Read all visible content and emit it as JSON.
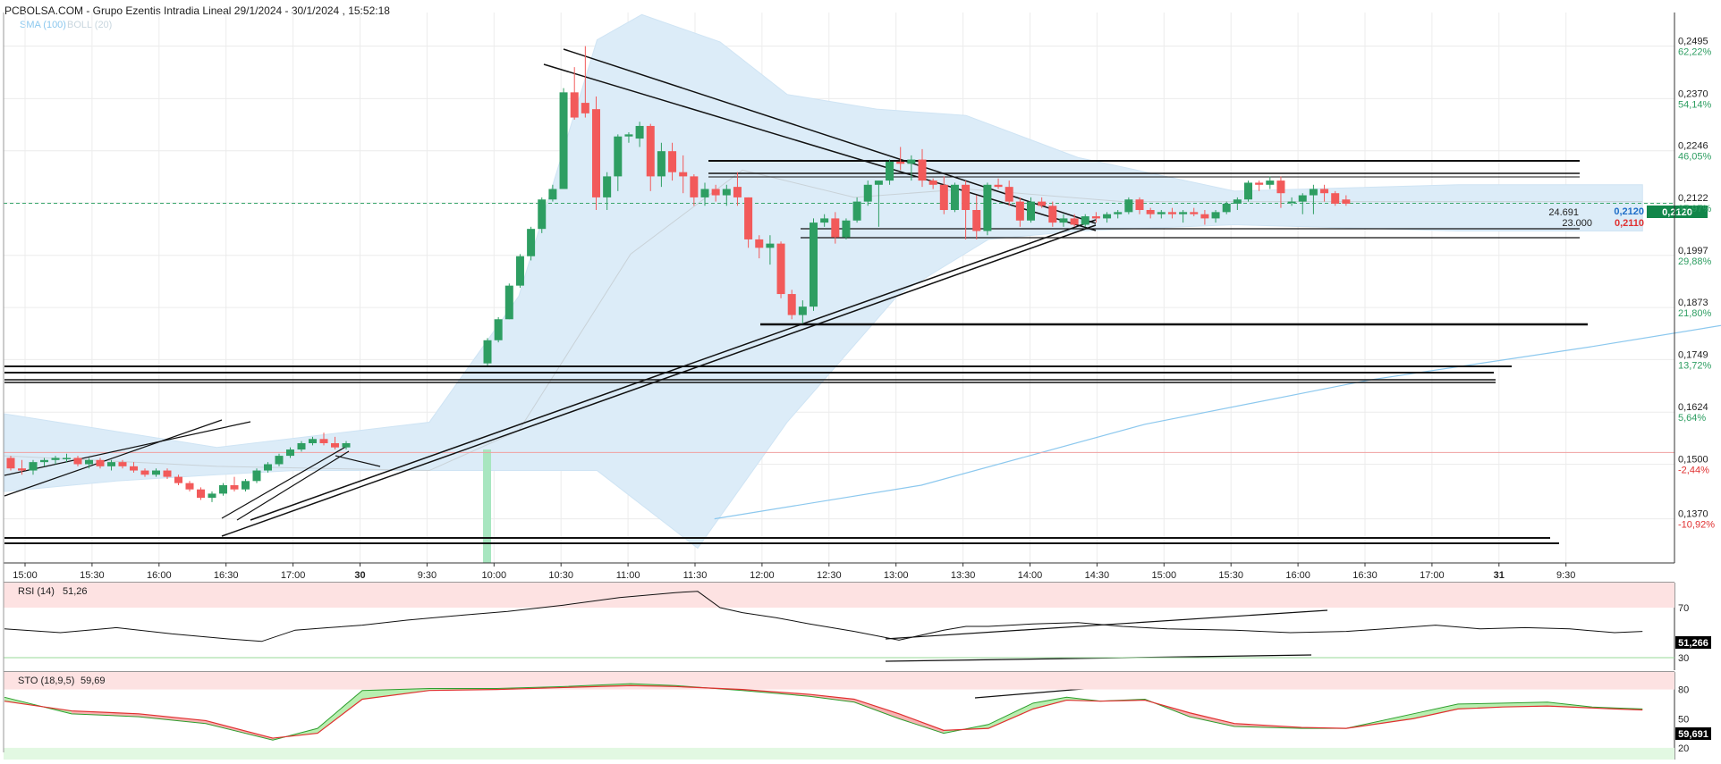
{
  "header": {
    "title": "PCBOLSA.COM - Grupo Ezentis Intradia Lineal 29/1/2024 - 30/1/2024 , 15:52:18",
    "legend": [
      {
        "label": "SMA (100)",
        "color": "#8cc8ee"
      },
      {
        "label": "BOLL (20)",
        "color": "#c8d6de"
      }
    ]
  },
  "colors": {
    "up": "#2e9e62",
    "down": "#f25a5a",
    "band": "#dcecf8",
    "sma": "#8cc8ee",
    "grid": "#ececec",
    "current_price_badge": "#12864a",
    "rsi_zone": "#fde2e2",
    "sto_low_zone": "#e2f8e2"
  },
  "chart_data": [
    {
      "type": "candlestick",
      "name": "price",
      "ylim": [
        0.1265,
        0.2575
      ],
      "y_ticks": [
        {
          "price": "0,2495",
          "pct": "62,22%"
        },
        {
          "price": "0,2370",
          "pct": "54,14%"
        },
        {
          "price": "0,2246",
          "pct": "46,05%"
        },
        {
          "price": "0,2122",
          "pct": "37,97%"
        },
        {
          "price": "0,1997",
          "pct": "29,88%"
        },
        {
          "price": "0,1873",
          "pct": "21,80%"
        },
        {
          "price": "0,1749",
          "pct": "13,72%"
        },
        {
          "price": "0,1624",
          "pct": "5,64%"
        },
        {
          "price": "0,1500",
          "pct": "-2,44%"
        },
        {
          "price": "0,1370",
          "pct": "-10,92%"
        }
      ],
      "x_ticks": [
        "15:00",
        "15:30",
        "16:00",
        "16:30",
        "17:00",
        "30",
        "9:30",
        "10:00",
        "10:30",
        "11:00",
        "11:30",
        "12:00",
        "12:30",
        "13:00",
        "13:30",
        "14:00",
        "14:30",
        "15:00",
        "15:30",
        "16:00",
        "16:30",
        "17:00",
        "31",
        "9:30"
      ],
      "price_tags": [
        {
          "text": "0,2120",
          "color": "#1e6ec8"
        },
        {
          "text": "0,2120",
          "color": "#12864a"
        },
        {
          "text": "0,2110",
          "color": "#e03030"
        }
      ],
      "volume_tags": [
        "24.691",
        "23.000"
      ],
      "candles": [
        [
          0.1515,
          0.152,
          0.1485,
          0.149
        ],
        [
          0.149,
          0.151,
          0.1475,
          0.1485
        ],
        [
          0.1485,
          0.151,
          0.1475,
          0.1505
        ],
        [
          0.1505,
          0.1515,
          0.1495,
          0.151
        ],
        [
          0.151,
          0.152,
          0.15,
          0.1515
        ],
        [
          0.1515,
          0.1525,
          0.1505,
          0.1515
        ],
        [
          0.1515,
          0.152,
          0.1495,
          0.15
        ],
        [
          0.15,
          0.1515,
          0.149,
          0.151
        ],
        [
          0.151,
          0.1515,
          0.149,
          0.1495
        ],
        [
          0.1495,
          0.151,
          0.1485,
          0.1505
        ],
        [
          0.1505,
          0.151,
          0.149,
          0.1495
        ],
        [
          0.1495,
          0.1505,
          0.148,
          0.1485
        ],
        [
          0.1485,
          0.149,
          0.147,
          0.1475
        ],
        [
          0.1475,
          0.149,
          0.147,
          0.1485
        ],
        [
          0.1485,
          0.149,
          0.1465,
          0.147
        ],
        [
          0.147,
          0.1475,
          0.145,
          0.1455
        ],
        [
          0.1455,
          0.146,
          0.1435,
          0.144
        ],
        [
          0.144,
          0.1445,
          0.1415,
          0.142
        ],
        [
          0.142,
          0.1435,
          0.141,
          0.143
        ],
        [
          0.143,
          0.1455,
          0.1425,
          0.145
        ],
        [
          0.145,
          0.147,
          0.1435,
          0.144
        ],
        [
          0.144,
          0.1465,
          0.1435,
          0.146
        ],
        [
          0.146,
          0.149,
          0.1455,
          0.1485
        ],
        [
          0.1485,
          0.1505,
          0.148,
          0.15
        ],
        [
          0.15,
          0.1525,
          0.1495,
          0.152
        ],
        [
          0.152,
          0.154,
          0.1515,
          0.1535
        ],
        [
          0.1535,
          0.1555,
          0.153,
          0.155
        ],
        [
          0.155,
          0.1565,
          0.1545,
          0.156
        ],
        [
          0.156,
          0.1575,
          0.1545,
          0.155
        ],
        [
          0.155,
          0.1565,
          0.1535,
          0.154
        ],
        [
          0.154,
          0.1555,
          0.1535,
          0.155
        ],
        [
          0.174,
          0.18,
          0.1735,
          0.1795
        ],
        [
          0.1795,
          0.185,
          0.179,
          0.1845
        ],
        [
          0.1845,
          0.193,
          0.1845,
          0.1925
        ],
        [
          0.1925,
          0.2,
          0.192,
          0.1995
        ],
        [
          0.1995,
          0.2065,
          0.1985,
          0.206
        ],
        [
          0.206,
          0.2135,
          0.205,
          0.213
        ],
        [
          0.213,
          0.2165,
          0.2125,
          0.2155
        ],
        [
          0.2155,
          0.2395,
          0.2155,
          0.2385
        ],
        [
          0.2385,
          0.2445,
          0.232,
          0.2325
        ],
        [
          0.236,
          0.2495,
          0.2325,
          0.2335
        ],
        [
          0.2345,
          0.2375,
          0.2105,
          0.2135
        ],
        [
          0.2135,
          0.2195,
          0.2105,
          0.2185
        ],
        [
          0.2185,
          0.2285,
          0.215,
          0.228
        ],
        [
          0.228,
          0.229,
          0.2265,
          0.2285
        ],
        [
          0.2275,
          0.2315,
          0.2255,
          0.2305
        ],
        [
          0.2305,
          0.231,
          0.215,
          0.2185
        ],
        [
          0.2185,
          0.2265,
          0.216,
          0.2245
        ],
        [
          0.2245,
          0.2265,
          0.2175,
          0.2195
        ],
        [
          0.2195,
          0.2235,
          0.2145,
          0.2185
        ],
        [
          0.2185,
          0.219,
          0.2115,
          0.2135
        ],
        [
          0.2135,
          0.217,
          0.2115,
          0.2155
        ],
        [
          0.2155,
          0.2165,
          0.2125,
          0.214
        ],
        [
          0.214,
          0.2165,
          0.2115,
          0.2155
        ],
        [
          0.216,
          0.2195,
          0.2115,
          0.2135
        ],
        [
          0.2135,
          0.2135,
          0.2015,
          0.2035
        ],
        [
          0.2035,
          0.2045,
          0.199,
          0.2015
        ],
        [
          0.2015,
          0.2045,
          0.1975,
          0.2025
        ],
        [
          0.2025,
          0.203,
          0.1895,
          0.1905
        ],
        [
          0.1905,
          0.1915,
          0.1845,
          0.1855
        ],
        [
          0.1855,
          0.189,
          0.1835,
          0.1875
        ],
        [
          0.1875,
          0.2085,
          0.1865,
          0.2075
        ],
        [
          0.2075,
          0.2095,
          0.2065,
          0.2085
        ],
        [
          0.2085,
          0.21,
          0.2025,
          0.204
        ],
        [
          0.204,
          0.2085,
          0.2035,
          0.208
        ],
        [
          0.208,
          0.2135,
          0.2075,
          0.2125
        ],
        [
          0.2125,
          0.2175,
          0.2115,
          0.2165
        ],
        [
          0.2165,
          0.2175,
          0.2065,
          0.2175
        ],
        [
          0.2175,
          0.2225,
          0.2165,
          0.222
        ],
        [
          0.222,
          0.2255,
          0.22,
          0.2215
        ],
        [
          0.2215,
          0.2235,
          0.2175,
          0.2225
        ],
        [
          0.2225,
          0.225,
          0.216,
          0.2175
        ],
        [
          0.2175,
          0.218,
          0.2155,
          0.2165
        ],
        [
          0.2165,
          0.2185,
          0.2095,
          0.2105
        ],
        [
          0.2105,
          0.217,
          0.21,
          0.2165
        ],
        [
          0.2165,
          0.2175,
          0.2035,
          0.2105
        ],
        [
          0.2105,
          0.214,
          0.2035,
          0.2055
        ],
        [
          0.2055,
          0.217,
          0.2045,
          0.2165
        ],
        [
          0.2165,
          0.218,
          0.2155,
          0.216
        ],
        [
          0.216,
          0.2175,
          0.2115,
          0.2125
        ],
        [
          0.2125,
          0.2135,
          0.2065,
          0.208
        ],
        [
          0.208,
          0.2135,
          0.2075,
          0.2125
        ],
        [
          0.2125,
          0.2135,
          0.211,
          0.2115
        ],
        [
          0.2115,
          0.2125,
          0.2065,
          0.2075
        ],
        [
          0.2075,
          0.2095,
          0.2065,
          0.2085
        ],
        [
          0.2085,
          0.2095,
          0.2065,
          0.207
        ],
        [
          0.207,
          0.2095,
          0.2065,
          0.209
        ],
        [
          0.209,
          0.21,
          0.2075,
          0.2085
        ],
        [
          0.2085,
          0.21,
          0.2075,
          0.2095
        ],
        [
          0.2095,
          0.2105,
          0.2085,
          0.21
        ],
        [
          0.21,
          0.2135,
          0.2095,
          0.213
        ],
        [
          0.213,
          0.2135,
          0.2095,
          0.2105
        ],
        [
          0.2105,
          0.211,
          0.2085,
          0.2095
        ],
        [
          0.2095,
          0.2105,
          0.2085,
          0.21
        ],
        [
          0.21,
          0.211,
          0.2085,
          0.2095
        ],
        [
          0.2095,
          0.2105,
          0.2075,
          0.21
        ],
        [
          0.21,
          0.211,
          0.209,
          0.2095
        ],
        [
          0.2095,
          0.2105,
          0.207,
          0.2085
        ],
        [
          0.2085,
          0.2105,
          0.2075,
          0.21
        ],
        [
          0.21,
          0.2125,
          0.2095,
          0.212
        ],
        [
          0.212,
          0.2135,
          0.2105,
          0.213
        ],
        [
          0.213,
          0.2175,
          0.2125,
          0.217
        ],
        [
          0.217,
          0.2175,
          0.215,
          0.2165
        ],
        [
          0.2165,
          0.2185,
          0.2155,
          0.2175
        ],
        [
          0.2175,
          0.2185,
          0.211,
          0.2145
        ],
        [
          0.2125,
          0.2135,
          0.2115,
          0.2125
        ],
        [
          0.2125,
          0.2145,
          0.2095,
          0.214
        ],
        [
          0.214,
          0.2165,
          0.2095,
          0.2155
        ],
        [
          0.2155,
          0.2165,
          0.2125,
          0.2145
        ],
        [
          0.2145,
          0.215,
          0.2115,
          0.212
        ],
        [
          0.213,
          0.214,
          0.2115,
          0.212
        ]
      ],
      "sma_100": [
        [
          15,
          0.1295
        ],
        [
          200,
          0.1375
        ],
        [
          400,
          0.152
        ],
        [
          600,
          0.1625
        ],
        [
          800,
          0.1705
        ],
        [
          1000,
          0.1792
        ],
        [
          1200,
          0.1872
        ],
        [
          1300,
          0.1901
        ],
        [
          1465,
          0.1925
        ]
      ],
      "boll_upper": [
        [
          0,
          0.162
        ],
        [
          190,
          0.154
        ],
        [
          380,
          0.16
        ],
        [
          460,
          0.19
        ],
        [
          530,
          0.251
        ],
        [
          570,
          0.257
        ],
        [
          640,
          0.2505
        ],
        [
          700,
          0.238
        ],
        [
          780,
          0.2345
        ],
        [
          860,
          0.233
        ],
        [
          960,
          0.223
        ],
        [
          1100,
          0.215
        ],
        [
          1300,
          0.2165
        ],
        [
          1465,
          0.2165
        ]
      ],
      "boll_lower": [
        [
          0,
          0.1435
        ],
        [
          100,
          0.146
        ],
        [
          190,
          0.1475
        ],
        [
          260,
          0.1485
        ],
        [
          380,
          0.1485
        ],
        [
          530,
          0.1485
        ],
        [
          620,
          0.13
        ],
        [
          700,
          0.16
        ],
        [
          800,
          0.1905
        ],
        [
          880,
          0.2035
        ],
        [
          960,
          0.2055
        ],
        [
          1100,
          0.207
        ],
        [
          1300,
          0.2055
        ],
        [
          1465,
          0.2055
        ]
      ],
      "boll_mid": [
        [
          0,
          0.152
        ],
        [
          190,
          0.1495
        ],
        [
          380,
          0.1485
        ],
        [
          460,
          0.158
        ],
        [
          560,
          0.2
        ],
        [
          660,
          0.22
        ],
        [
          760,
          0.2135
        ],
        [
          860,
          0.2155
        ],
        [
          1000,
          0.2125
        ],
        [
          1465,
          0.2125
        ]
      ]
    },
    {
      "type": "line",
      "name": "RSI (14)",
      "label": "RSI (14)",
      "value_label": "51,26",
      "current_badge": "51,266",
      "ylim": [
        20,
        90
      ],
      "levels": [
        70,
        30
      ],
      "level_labels": [
        "70",
        "30"
      ],
      "x": [
        0,
        50,
        100,
        150,
        200,
        230,
        260,
        290,
        320,
        360,
        410,
        450,
        500,
        550,
        600,
        620,
        640,
        660,
        690,
        720,
        760,
        800,
        840,
        860,
        880,
        920,
        960,
        1000,
        1040,
        1100,
        1150,
        1200,
        1250,
        1280,
        1320,
        1360,
        1400,
        1440,
        1465
      ],
      "values": [
        53,
        50,
        54,
        49,
        45,
        43,
        52,
        54,
        56,
        60,
        64,
        67,
        72,
        78,
        82,
        83,
        70,
        66,
        62,
        57,
        51,
        44,
        52,
        55,
        55,
        57,
        58,
        55,
        53,
        52,
        50,
        51,
        54,
        56,
        53,
        54,
        53,
        50,
        51
      ]
    },
    {
      "type": "area",
      "name": "STO (18,9,5)",
      "label": "STO (18,9,5)",
      "value_label": "59,69",
      "current_badge": "59,691",
      "ylim": [
        8,
        98
      ],
      "levels": [
        80,
        50,
        20
      ],
      "level_labels": [
        "80",
        "50",
        "20"
      ],
      "x": [
        0,
        60,
        120,
        180,
        240,
        280,
        320,
        380,
        440,
        500,
        560,
        600,
        660,
        720,
        760,
        800,
        840,
        880,
        920,
        950,
        980,
        1020,
        1060,
        1100,
        1160,
        1200,
        1260,
        1300,
        1340,
        1380,
        1420,
        1440,
        1465
      ],
      "k": [
        72,
        55,
        52,
        45,
        28,
        40,
        79,
        81,
        81,
        83,
        86,
        84,
        79,
        73,
        67,
        50,
        35,
        44,
        66,
        72,
        68,
        70,
        52,
        42,
        40,
        40,
        55,
        65,
        66,
        67,
        62,
        61,
        60
      ],
      "d": [
        68,
        58,
        55,
        48,
        30,
        35,
        70,
        79,
        80,
        82,
        84,
        83,
        80,
        75,
        70,
        55,
        38,
        40,
        60,
        69,
        68,
        69,
        56,
        45,
        41,
        40,
        50,
        60,
        62,
        63,
        61,
        60,
        59
      ]
    }
  ]
}
